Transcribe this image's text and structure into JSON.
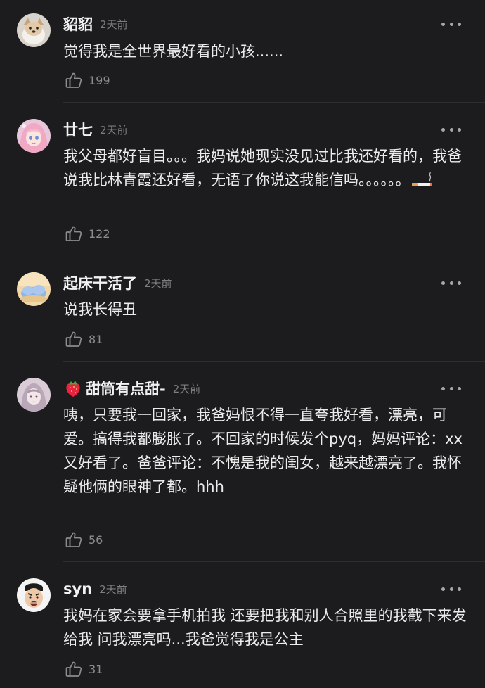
{
  "comments": [
    {
      "username": "貂貂",
      "time": "2天前",
      "text": "觉得我是全世界最好看的小孩......",
      "likes": "199",
      "avatar_icon": "dog-avatar-icon"
    },
    {
      "username": "廿七",
      "time": "2天前",
      "text": "我父母都好盲目。。。我妈说她现实没见过比我还好看的，我爸说我比林青霞还好看，无语了你说这我能信吗。。。。。。",
      "likes": "122",
      "avatar_icon": "anime-girl-avatar-icon",
      "trailing_emoji": "cigarette-emoji"
    },
    {
      "username": "起床干活了",
      "time": "2天前",
      "text": "说我长得丑",
      "likes": "81",
      "avatar_icon": "cloud-avatar-icon"
    },
    {
      "username": "甜筒有点甜-",
      "time": "2天前",
      "text": "咦，只要我一回家，我爸妈恨不得一直夸我好看，漂亮，可爱。搞得我都膨胀了。不回家的时候发个pyq，妈妈评论：xx又好看了。爸爸评论：不愧是我的闺女，越来越漂亮了。我怀疑他俩的眼神了都。hhh",
      "likes": "56",
      "avatar_icon": "girl-avatar-icon",
      "name_emoji": "strawberry-emoji"
    },
    {
      "username": "syn",
      "time": "2天前",
      "text": "我妈在家会要拿手机拍我 还要把我和别人合照里的我截下来发给我 问我漂亮吗...我爸觉得我是公主",
      "likes": "31",
      "avatar_icon": "meme-face-avatar-icon"
    }
  ],
  "colors": {
    "background": "#1c1c1e",
    "text": "#ececec",
    "meta": "#7e7e82",
    "divider": "#2e2e32"
  }
}
